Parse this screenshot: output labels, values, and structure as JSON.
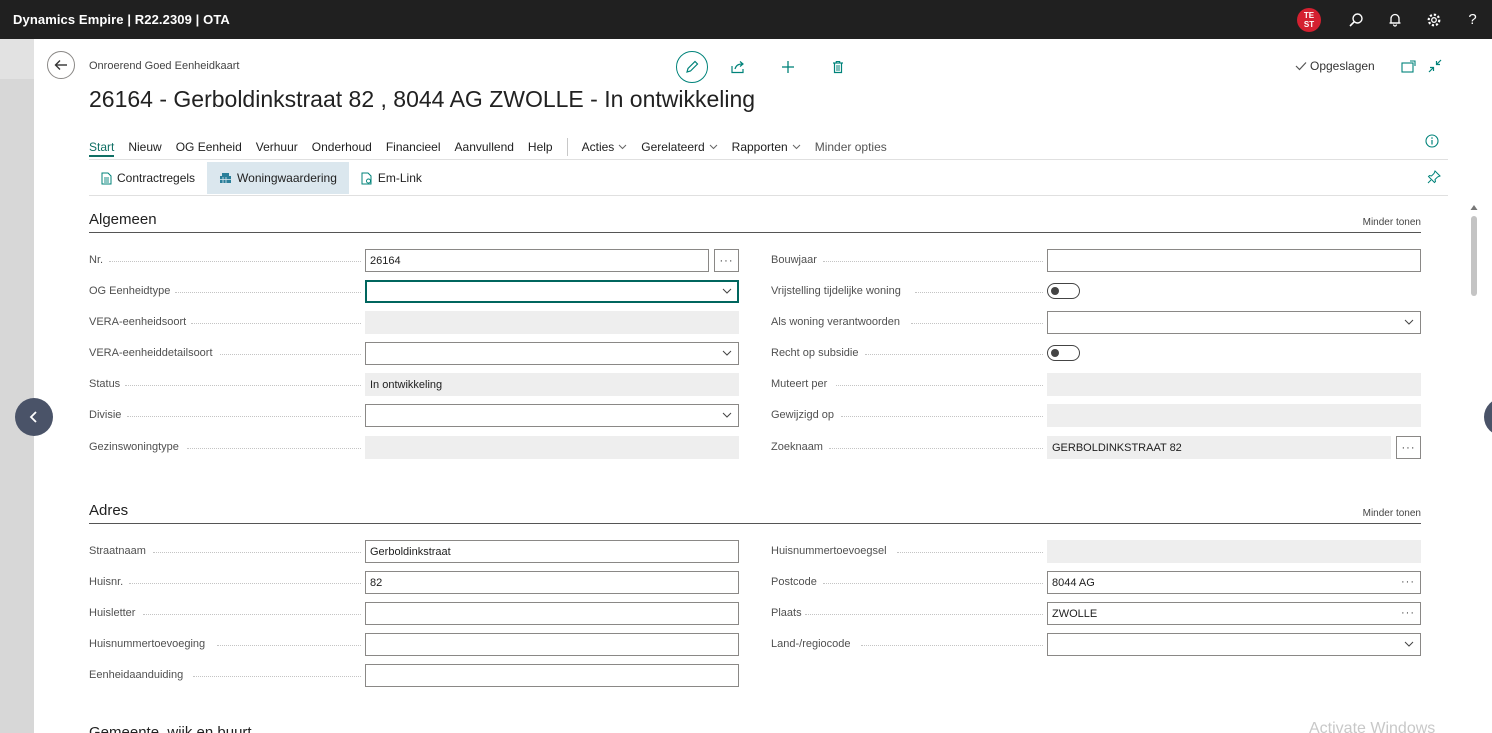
{
  "app": {
    "title": "Dynamics Empire | R22.2309 | OTA",
    "avatar_initials_top": "TE",
    "avatar_initials_bottom": "ST",
    "help_label": "?"
  },
  "page": {
    "breadcrumb": "Onroerend Goed Eenheidkaart",
    "title": "26164 - Gerboldinkstraat 82 , 8044 AG ZWOLLE - In ontwikkeling",
    "saved_label": "Opgeslagen"
  },
  "menu": {
    "items": [
      "Start",
      "Nieuw",
      "OG Eenheid",
      "Verhuur",
      "Onderhoud",
      "Financieel",
      "Aanvullend",
      "Help"
    ],
    "dropdowns": [
      "Acties",
      "Gerelateerd",
      "Rapporten"
    ],
    "less_options": "Minder opties"
  },
  "subbar": {
    "items": [
      "Contractregels",
      "Woningwaardering",
      "Em-Link"
    ]
  },
  "algemeen": {
    "title": "Algemeen",
    "less_label": "Minder tonen",
    "left": [
      {
        "label": "Nr.",
        "value": "26164"
      },
      {
        "label": "OG Eenheidtype",
        "value": ""
      },
      {
        "label": "VERA-eenheidsoort",
        "value": ""
      },
      {
        "label": "VERA-eenheiddetailsoort",
        "value": ""
      },
      {
        "label": "Status",
        "value": "In ontwikkeling"
      },
      {
        "label": "Divisie",
        "value": ""
      },
      {
        "label": "Gezinswoningtype",
        "value": ""
      }
    ],
    "right": [
      {
        "label": "Bouwjaar",
        "value": ""
      },
      {
        "label": "Vrijstelling tijdelijke woning",
        "value": ""
      },
      {
        "label": "Als woning verantwoorden",
        "value": ""
      },
      {
        "label": "Recht op subsidie",
        "value": ""
      },
      {
        "label": "Muteert per",
        "value": ""
      },
      {
        "label": "Gewijzigd op",
        "value": ""
      },
      {
        "label": "Zoeknaam",
        "value": "GERBOLDINKSTRAAT 82"
      }
    ]
  },
  "adres": {
    "title": "Adres",
    "less_label": "Minder tonen",
    "left": [
      {
        "label": "Straatnaam",
        "value": "Gerboldinkstraat"
      },
      {
        "label": "Huisnr.",
        "value": "82"
      },
      {
        "label": "Huisletter",
        "value": ""
      },
      {
        "label": "Huisnummertoevoeging",
        "value": ""
      },
      {
        "label": "Eenheidaanduiding",
        "value": ""
      }
    ],
    "right": [
      {
        "label": "Huisnummertoevoegsel",
        "value": ""
      },
      {
        "label": "Postcode",
        "value": "8044 AG"
      },
      {
        "label": "Plaats",
        "value": "ZWOLLE"
      },
      {
        "label": "Land-/regiocode",
        "value": ""
      }
    ]
  },
  "next_section": "Gemeente, wijk en buurt",
  "watermark": "Activate Windows",
  "ellipsis": "···"
}
